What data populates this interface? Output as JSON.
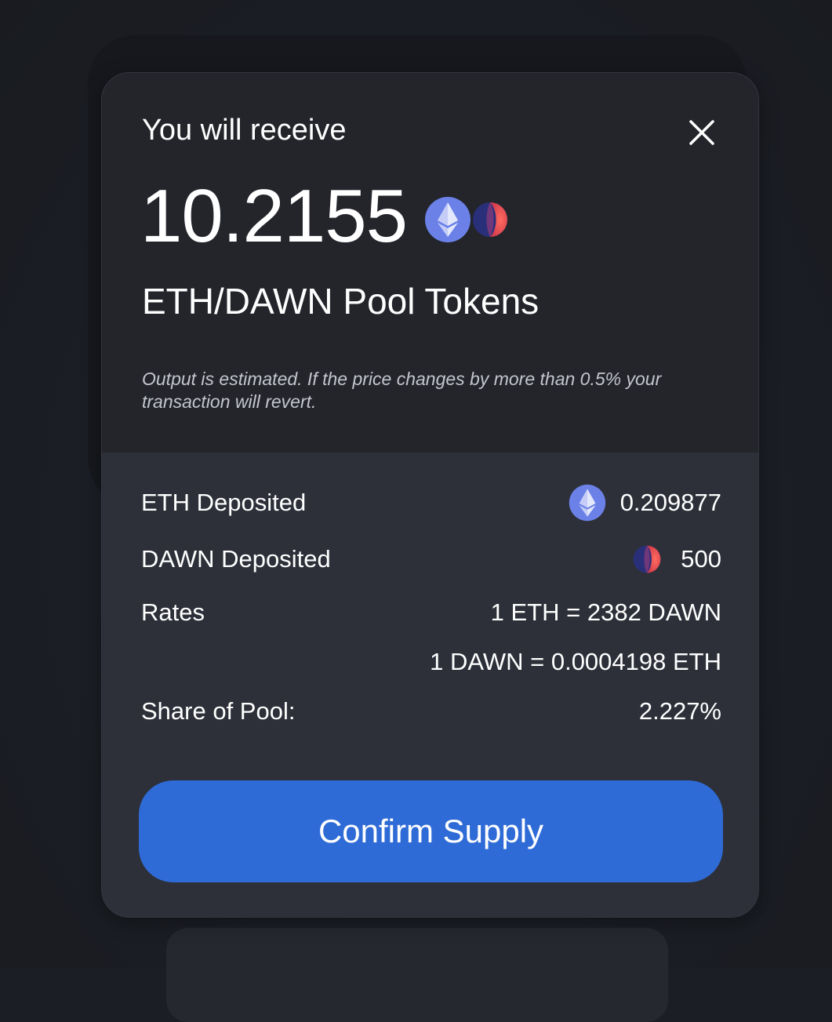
{
  "modal": {
    "title": "You will receive",
    "amount": "10.2155",
    "pool_name": "ETH/DAWN Pool Tokens",
    "estimate_note": "Output is estimated. If the price changes by more than 0.5% your transaction will revert."
  },
  "details": {
    "eth_deposited_label": "ETH Deposited",
    "eth_deposited_value": "0.209877",
    "dawn_deposited_label": "DAWN Deposited",
    "dawn_deposited_value": "500",
    "rates_label": "Rates",
    "rate_1": "1 ETH = 2382 DAWN",
    "rate_2": "1 DAWN = 0.0004198 ETH",
    "share_label": "Share of Pool:",
    "share_value": "2.227%"
  },
  "actions": {
    "confirm_label": "Confirm Supply"
  },
  "icons": {
    "close": "close-icon",
    "eth": "eth-token-icon",
    "dawn": "dawn-token-icon"
  },
  "colors": {
    "accent": "#2f6bd6",
    "eth": "#6b81e8",
    "dawn": "#e8504a"
  }
}
